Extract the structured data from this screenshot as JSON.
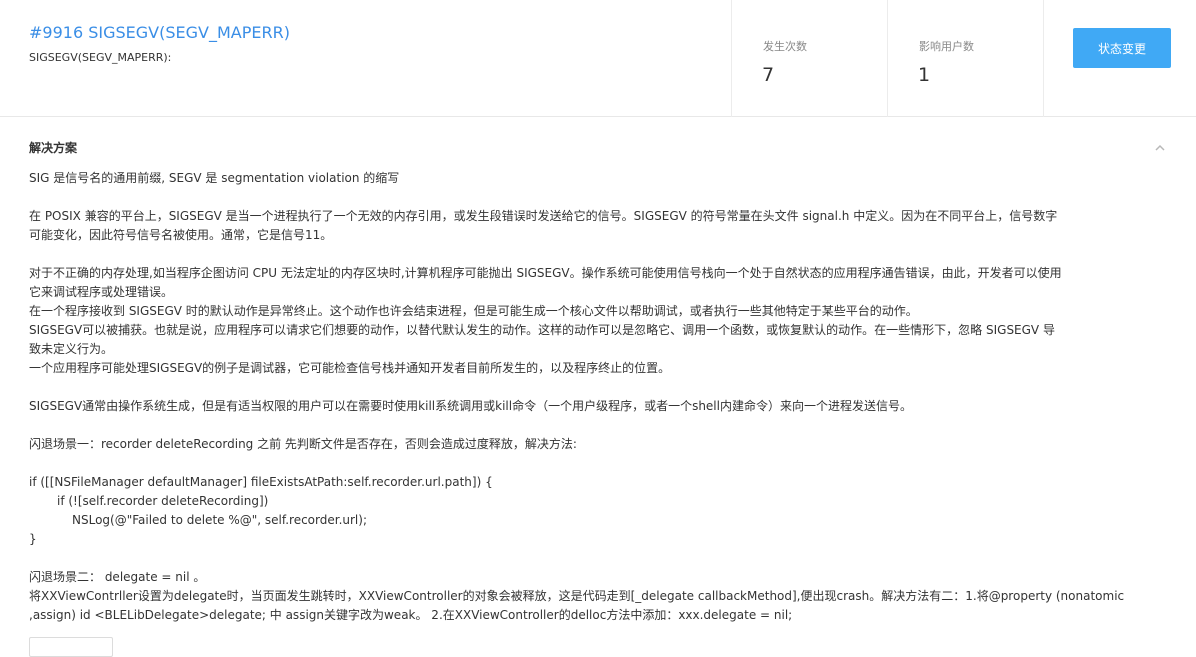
{
  "issue": {
    "title": "#9916 SIGSEGV(SEGV_MAPERR)",
    "subtitle": "SIGSEGV(SEGV_MAPERR):"
  },
  "stats": {
    "occurrences_label": "发生次数",
    "occurrences_value": "7",
    "affected_users_label": "影响用户数",
    "affected_users_value": "1"
  },
  "actions": {
    "status_change": "状态变更"
  },
  "solution": {
    "heading": "解决方案",
    "lines": [
      "SIG 是信号名的通用前缀, SEGV 是 segmentation violation 的缩写",
      "在 POSIX 兼容的平台上，SIGSEGV 是当一个进程执行了一个无效的内存引用，或发生段错误时发送给它的信号。SIGSEGV 的符号常量在头文件 signal.h 中定义。因为在不同平台上，信号数字",
      "可能变化，因此符号信号名被使用。通常，它是信号11。",
      "对于不正确的内存处理,如当程序企图访问 CPU 无法定址的内存区块时,计算机程序可能抛出 SIGSEGV。操作系统可能使用信号栈向一个处于自然状态的应用程序通告错误，由此，开发者可以使用",
      "它来调试程序或处理错误。",
      "在一个程序接收到 SIGSEGV 时的默认动作是异常终止。这个动作也许会结束进程，但是可能生成一个核心文件以帮助调试，或者执行一些其他特定于某些平台的动作。",
      "SIGSEGV可以被捕获。也就是说，应用程序可以请求它们想要的动作，以替代默认发生的动作。这样的动作可以是忽略它、调用一个函数，或恢复默认的动作。在一些情形下，忽略 SIGSEGV 导",
      "致未定义行为。",
      "一个应用程序可能处理SIGSEGV的例子是调试器，它可能检查信号栈并通知开发者目前所发生的，以及程序终止的位置。",
      "SIGSEGV通常由操作系统生成，但是有适当权限的用户可以在需要时使用kill系统调用或kill命令（一个用户级程序，或者一个shell内建命令）来向一个进程发送信号。",
      "闪退场景一：recorder deleteRecording  之前 先判断文件是否存在，否则会造成过度释放，解决方法:",
      "if ([[NSFileManager defaultManager] fileExistsAtPath:self.recorder.url.path]) {",
      "if (![self.recorder deleteRecording])",
      "NSLog(@\"Failed to delete %@\", self.recorder.url);",
      "}",
      "闪退场景二： delegate = nil 。",
      "将XXViewContrller设置为delegate时，当页面发生跳转时，XXViewController的对象会被释放，这是代码走到[_delegate callbackMethod],便出现crash。解决方法有二：1.将@property (nonatomic",
      ",assign) id <BLELibDelegate>delegate; 中 assign关键字改为weak。 2.在XXViewController的delloc方法中添加：xxx.delegate = nil;"
    ]
  },
  "icons": {
    "collapse": "chevron-up-icon"
  },
  "colors": {
    "link": "#3a8ee6",
    "primary_button": "#40a9f5"
  }
}
